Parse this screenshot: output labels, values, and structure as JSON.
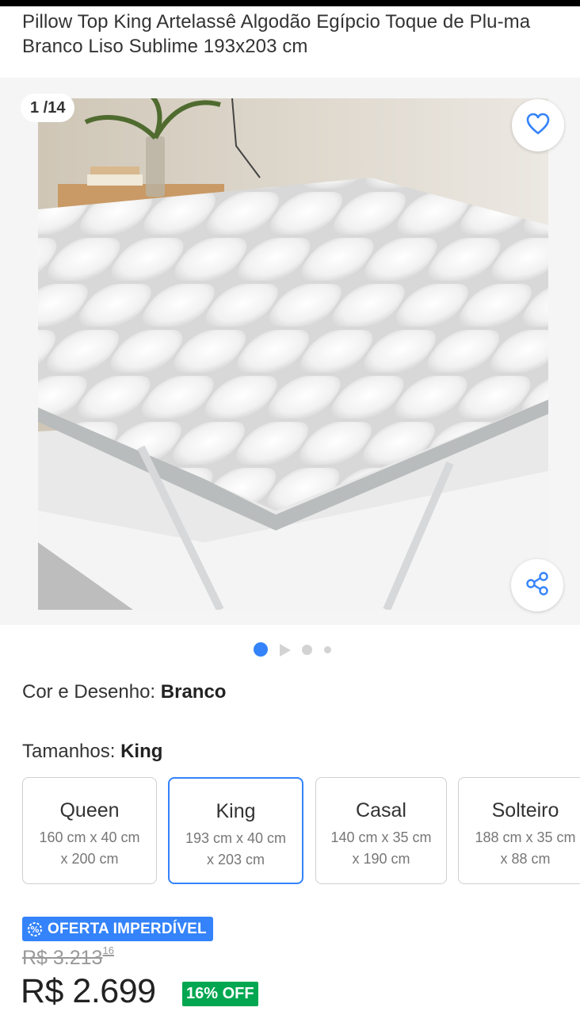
{
  "product": {
    "title": "Pillow Top King Artelassê Algodão Egípcio Toque de Plu-ma Branco Liso Sublime 193x203 cm"
  },
  "gallery": {
    "counter": "1 /14",
    "active_index": 1,
    "total": 14,
    "favorite_icon": "heart-icon",
    "share_icon": "share-icon"
  },
  "color": {
    "label": "Cor e Desenho:",
    "value": "Branco"
  },
  "sizes": {
    "label": "Tamanhos:",
    "value": "King",
    "options": [
      {
        "name": "Queen",
        "desc": "160 cm x 40 cm x 200 cm"
      },
      {
        "name": "King",
        "desc": "193 cm x 40 cm x 203 cm"
      },
      {
        "name": "Casal",
        "desc": "140 cm x 35 cm x 190 cm"
      },
      {
        "name": "Solteiro",
        "desc": "188 cm x 35 cm x 88 cm"
      }
    ],
    "selected": "King"
  },
  "offer": {
    "badge": "OFERTA IMPERDÍVEL",
    "badge_color": "#3483fa"
  },
  "price": {
    "old_integer": "R$ 3.213",
    "old_cents": "16",
    "current": "R$ 2.699",
    "discount": "16% OFF",
    "discount_color": "#00a650"
  }
}
